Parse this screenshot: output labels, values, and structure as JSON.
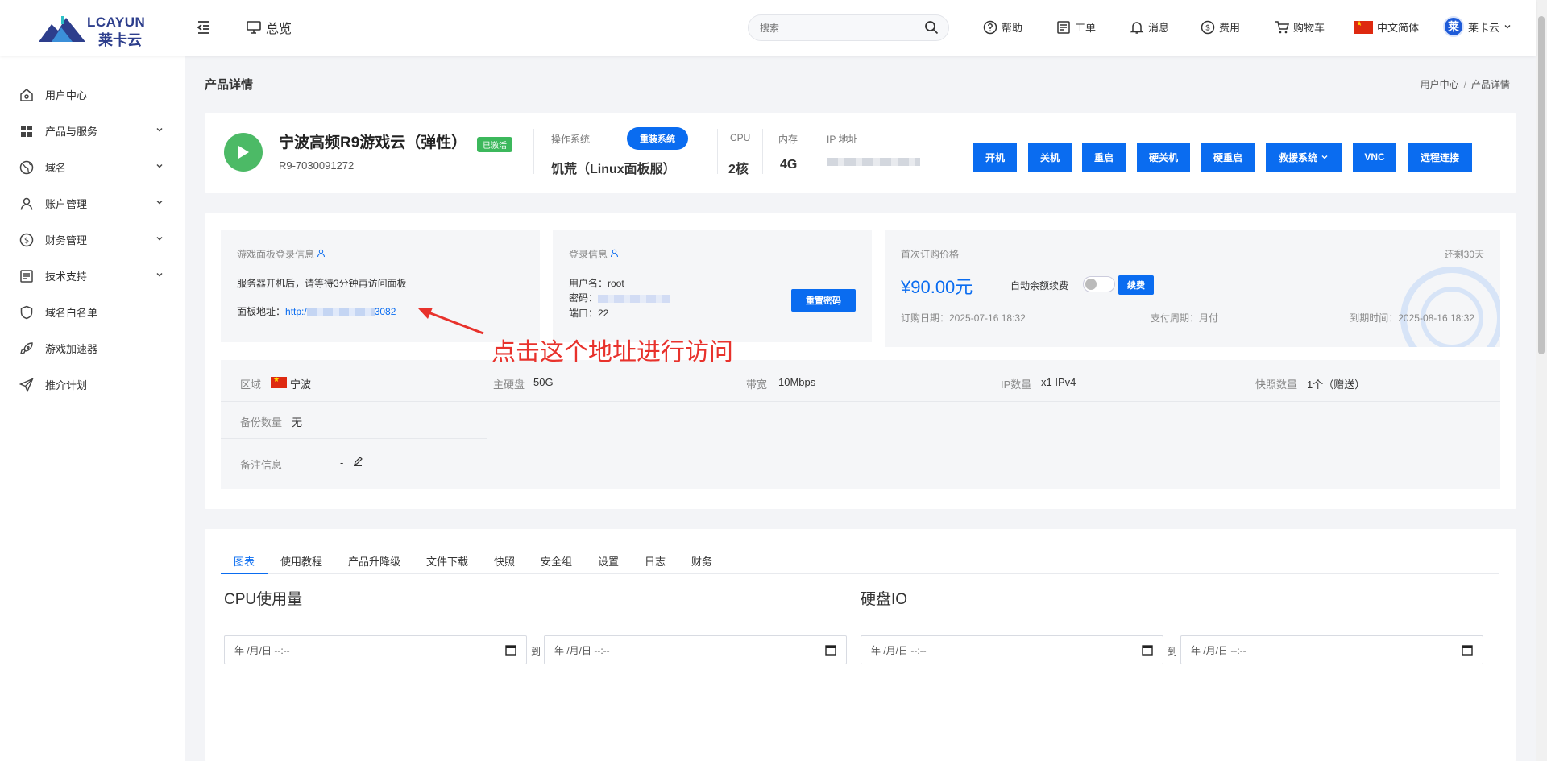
{
  "header": {
    "logo_text": "LCAYUN",
    "logo_cn": "莱卡云",
    "overview_label": "总览",
    "search_placeholder": "搜索",
    "nav": {
      "help": "帮助",
      "ticket": "工单",
      "message": "消息",
      "billing": "费用",
      "cart": "购物车",
      "language": "中文简体",
      "user": "莱卡云",
      "avatar_char": "莱"
    }
  },
  "sidebar": {
    "items": [
      {
        "label": "用户中心",
        "icon": "home-icon",
        "expandable": false
      },
      {
        "label": "产品与服务",
        "icon": "grid-icon",
        "expandable": true
      },
      {
        "label": "域名",
        "icon": "globe-icon",
        "expandable": true
      },
      {
        "label": "账户管理",
        "icon": "user-icon",
        "expandable": true
      },
      {
        "label": "财务管理",
        "icon": "dollar-icon",
        "expandable": true
      },
      {
        "label": "技术支持",
        "icon": "document-icon",
        "expandable": true
      },
      {
        "label": "域名白名单",
        "icon": "shield-icon",
        "expandable": false
      },
      {
        "label": "游戏加速器",
        "icon": "rocket-icon",
        "expandable": false
      },
      {
        "label": "推介计划",
        "icon": "send-icon",
        "expandable": false
      }
    ]
  },
  "page": {
    "title": "产品详情",
    "breadcrumb": [
      "用户中心",
      "产品详情"
    ],
    "breadcrumb_sep": "/"
  },
  "product": {
    "name": "宁波高频R9游戏云（弹性）",
    "status": "已激活",
    "id": "R9-7030091272",
    "os_label": "操作系统",
    "reinstall": "重装系统",
    "os_value": "饥荒（Linux面板服）",
    "cpu_label": "CPU",
    "cpu_value": "2核",
    "mem_label": "内存",
    "mem_value": "4G",
    "ip_label": "IP 地址",
    "actions": [
      "开机",
      "关机",
      "重启",
      "硬关机",
      "硬重启",
      "救援系统",
      "VNC",
      "远程连接"
    ]
  },
  "panel_info": {
    "title": "游戏面板登录信息",
    "notice": "服务器开机后，请等待3分钟再访问面板",
    "addr_label": "面板地址：",
    "addr_prefix": "http:/",
    "addr_suffix": "3082"
  },
  "login_info": {
    "title": "登录信息",
    "username": "用户名：root",
    "password_label": "密码：",
    "port": "端口：22",
    "reset_btn": "重置密码"
  },
  "price": {
    "title": "首次订购价格",
    "remaining": "还剩30天",
    "amount": "¥90.00元",
    "auto_renew": "自动余额续费",
    "renew_btn": "续费",
    "order_date": "订购日期：2025-07-16 18:32",
    "cycle": "支付周期：月付",
    "expire": "到期时间：2025-08-16 18:32"
  },
  "specs": {
    "region_label": "区域",
    "region_value": "宁波",
    "disk_label": "主硬盘",
    "disk_value": "50G",
    "bandwidth_label": "带宽",
    "bandwidth_value": "10Mbps",
    "ip_label": "IP数量",
    "ip_value": "x1 IPv4",
    "snapshot_label": "快照数量",
    "snapshot_value": "1个（赠送）",
    "backup_label": "备份数量",
    "backup_value": "无",
    "note_label": "备注信息",
    "note_value": "-"
  },
  "tabs": [
    "图表",
    "使用教程",
    "产品升降级",
    "文件下载",
    "快照",
    "安全组",
    "设置",
    "日志",
    "财务"
  ],
  "charts": {
    "cpu_title": "CPU使用量",
    "disk_title": "硬盘IO",
    "date_placeholder": "年 /月/日 --:--",
    "to": "到"
  },
  "annotation": "点击这个地址进行访问",
  "colors": {
    "primary": "#0a6cf0",
    "active_green": "#3cb85c",
    "annotation_red": "#e8322c"
  }
}
